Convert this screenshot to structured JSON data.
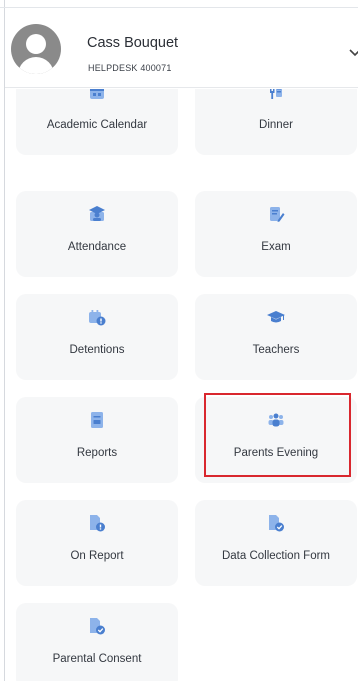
{
  "header": {
    "user_name": "Cass Bouquet",
    "user_subtitle": "HELPDESK 400071",
    "avatar_icon": "user-avatar-icon",
    "expand_icon": "chevron-down-icon"
  },
  "menu": {
    "items": [
      {
        "label": "Academic Calendar",
        "icon": "calendar-icon"
      },
      {
        "label": "Dinner",
        "icon": "cutlery-icon"
      },
      {
        "label": "Attendance",
        "icon": "attendance-icon"
      },
      {
        "label": "Exam",
        "icon": "exam-pencil-icon"
      },
      {
        "label": "Detentions",
        "icon": "calendar-alert-icon"
      },
      {
        "label": "Teachers",
        "icon": "graduation-cap-icon"
      },
      {
        "label": "Reports",
        "icon": "report-document-icon"
      },
      {
        "label": "Parents Evening",
        "icon": "people-group-icon"
      },
      {
        "label": "On Report",
        "icon": "document-alert-icon"
      },
      {
        "label": "Data Collection Form",
        "icon": "document-check-icon"
      },
      {
        "label": "Parental Consent",
        "icon": "document-check-icon"
      }
    ],
    "highlighted": "Parents Evening"
  },
  "colors": {
    "icon_blue": "#4a7fcf",
    "icon_light_blue": "#8db3ea",
    "tile_background": "#f6f7f8",
    "highlight_red": "#d9272e"
  }
}
